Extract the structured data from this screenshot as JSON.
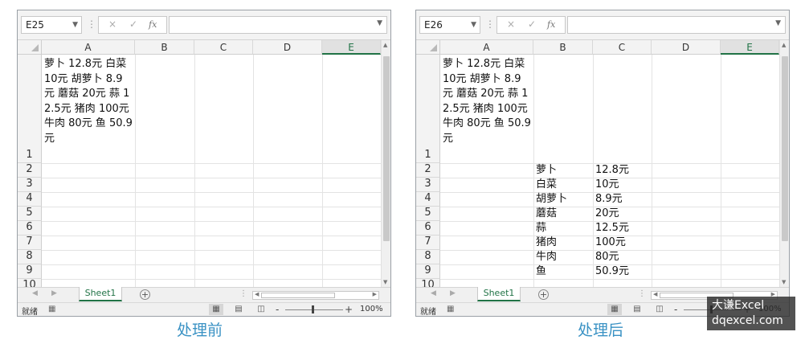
{
  "columns": [
    "A",
    "B",
    "C",
    "D",
    "E"
  ],
  "rows": [
    "1",
    "2",
    "3",
    "4",
    "5",
    "6",
    "7",
    "8",
    "9",
    "10"
  ],
  "wrapped_text": "萝卜 12.8元 白菜 10元 胡萝卜 8.9元 蘑菇 20元 蒜 12.5元 猪肉 100元  牛肉 80元 鱼 50.9元",
  "before": {
    "name_box": "E25",
    "caption": "处理前"
  },
  "after": {
    "name_box": "E26",
    "caption": "处理后",
    "items": [
      {
        "name": "萝卜",
        "price": "12.8元"
      },
      {
        "name": "白菜",
        "price": "10元"
      },
      {
        "name": "胡萝卜",
        "price": "8.9元"
      },
      {
        "name": "蘑菇",
        "price": "20元"
      },
      {
        "name": "蒜",
        "price": "12.5元"
      },
      {
        "name": "猪肉",
        "price": "100元"
      },
      {
        "name": "牛肉",
        "price": "80元"
      },
      {
        "name": "鱼",
        "price": "50.9元"
      }
    ]
  },
  "sheet_tab": "Sheet1",
  "status": {
    "ready": "就绪",
    "zoom": "100%"
  },
  "icons": {
    "cancel": "×",
    "enter": "✓",
    "function": "fx",
    "dropdown": "chevron-down",
    "add_sheet": "+",
    "zoom_out": "-",
    "zoom_in": "+"
  },
  "watermark": {
    "line1": "大谦Excel",
    "line2": "dqexcel.com"
  },
  "colors": {
    "accent": "#217346",
    "caption": "#3a92c4"
  }
}
